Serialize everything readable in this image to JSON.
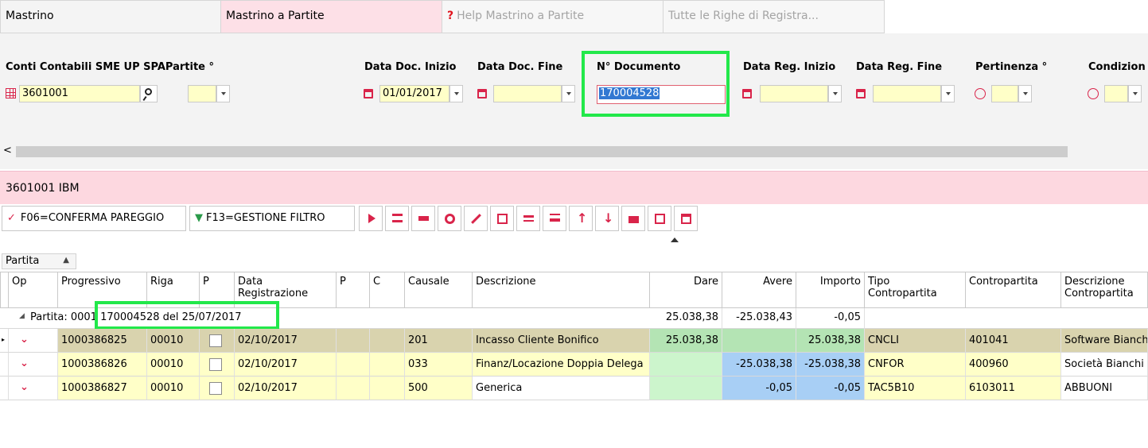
{
  "tabs": [
    {
      "label": "Mastrino"
    },
    {
      "label": "Mastrino a Partite"
    },
    {
      "label": "Help Mastrino a Partite",
      "icon": "question-icon"
    },
    {
      "label": "Tutte le Righe di Registra..."
    }
  ],
  "filters": {
    "conti_label": "Conti Contabili SME UP SPA",
    "partite_label": "Partite °",
    "conto_value": "3601001",
    "data_doc_inizio_label": "Data Doc. Inizio",
    "data_doc_inizio_value": "01/01/2017",
    "data_doc_fine_label": "Data Doc. Fine",
    "n_documento_label": "N° Documento",
    "n_documento_value": "170004528",
    "data_reg_inizio_label": "Data Reg. Inizio",
    "data_reg_fine_label": "Data Reg. Fine",
    "pertinenza_label": "Pertinenza °",
    "condizion_label": "Condizion"
  },
  "scroll_left": "<",
  "account_title": "3601001 IBM",
  "toolbar": {
    "conferma_label": "F06=CONFERMA PAREGGIO",
    "filtro_label": "F13=GESTIONE FILTRO"
  },
  "group_chip": "Partita",
  "grid": {
    "headers": [
      "Op",
      "Progressivo",
      "Riga",
      "P",
      "Data Registrazione",
      "P",
      "C",
      "Causale",
      "Descrizione",
      "Dare",
      "Avere",
      "Importo",
      "Tipo Contropartita",
      "Contropartita",
      "Descrizione Contropartita"
    ],
    "group_row": {
      "label": "Partita: 0001 170004528 del 25/07/2017",
      "dare": "25.038,38",
      "avere": "-25.038,43",
      "importo": "-0,05"
    },
    "rows": [
      {
        "progressivo": "1000386825",
        "riga": "00010",
        "data": "02/10/2017",
        "causale": "201",
        "descrizione": "Incasso Cliente Bonifico",
        "dare": "25.038,38",
        "avere": "",
        "importo": "25.038,38",
        "tipo": "CNCLI",
        "contropartita": "401041",
        "desc_contropartita": "Software Bianchi"
      },
      {
        "progressivo": "1000386826",
        "riga": "00010",
        "data": "02/10/2017",
        "causale": "033",
        "descrizione": "Finanz/Locazione Doppia Delega",
        "dare": "",
        "avere": "-25.038,38",
        "importo": "-25.038,38",
        "tipo": "CNFOR",
        "contropartita": "400960",
        "desc_contropartita": "Società Bianchi"
      },
      {
        "progressivo": "1000386827",
        "riga": "00010",
        "data": "02/10/2017",
        "causale": "500",
        "descrizione": "Generica",
        "dare": "",
        "avere": "-0,05",
        "importo": "-0,05",
        "tipo": "TAC5B10",
        "contropartita": "6103011",
        "desc_contropartita": "ABBUONI"
      }
    ]
  },
  "colors": {
    "accent": "#d9244a",
    "highlight": "#22e84a",
    "input_yellow": "#ffffc8",
    "pink": "#fdd8e0"
  }
}
